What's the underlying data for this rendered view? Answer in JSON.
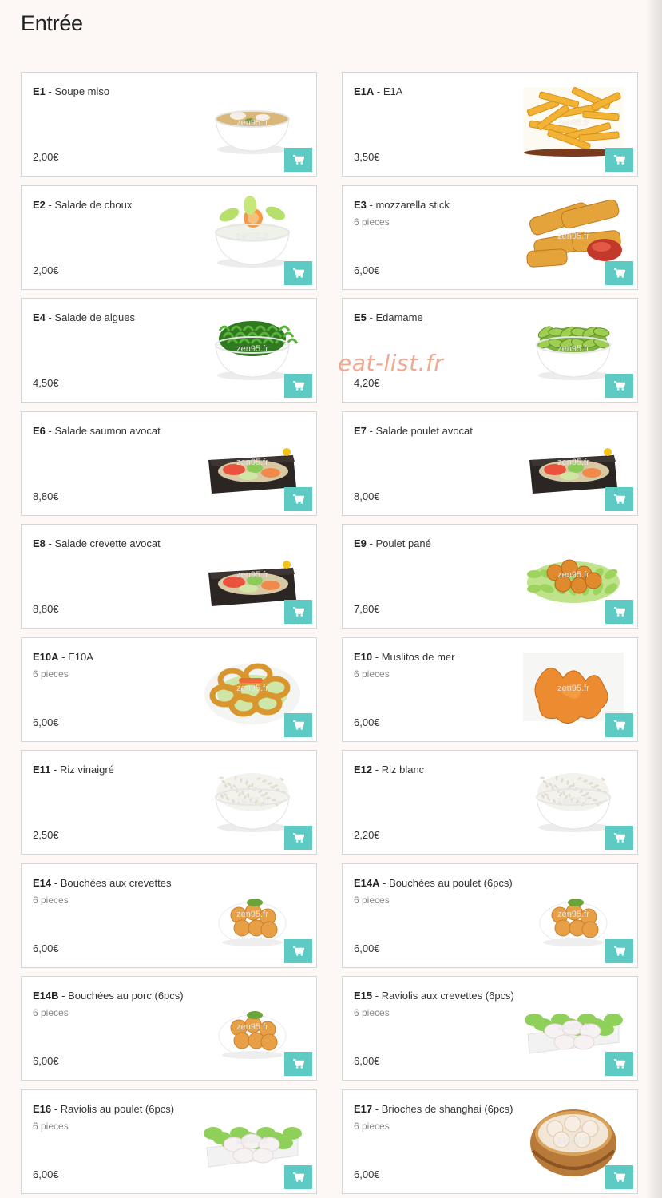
{
  "page": {
    "title": "Entrée"
  },
  "watermark": "eat-list.fr",
  "colors": {
    "cart_button": "#5dcbc3",
    "card_border": "#d6d6d6",
    "page_background": "#fdf8f6"
  },
  "items": [
    {
      "code": "E1",
      "name": "Soupe miso",
      "price": "2,00€",
      "desc": "",
      "image": "soup",
      "watermark": "zen95.fr"
    },
    {
      "code": "E1A",
      "name": "E1A",
      "price": "3,50€",
      "desc": "",
      "image": "fries",
      "watermark": "zen95.fr"
    },
    {
      "code": "E2",
      "name": "Salade de choux",
      "price": "2,00€",
      "desc": "",
      "image": "cabbage",
      "watermark": "zen95.fr"
    },
    {
      "code": "E3",
      "name": "mozzarella stick",
      "price": "6,00€",
      "desc": "6 pieces",
      "image": "sticks",
      "watermark": "zen95.fr"
    },
    {
      "code": "E4",
      "name": "Salade de algues",
      "price": "4,50€",
      "desc": "",
      "image": "seaweed",
      "watermark": "zen95.fr"
    },
    {
      "code": "E5",
      "name": "Edamame",
      "price": "4,20€",
      "desc": "",
      "image": "edamame",
      "watermark": "zen95.fr"
    },
    {
      "code": "E6",
      "name": "Salade saumon avocat",
      "price": "8,80€",
      "desc": "",
      "image": "salad-plate",
      "watermark": "zen95.fr"
    },
    {
      "code": "E7",
      "name": "Salade poulet avocat",
      "price": "8,00€",
      "desc": "",
      "image": "salad-plate",
      "watermark": "zen95.fr"
    },
    {
      "code": "E8",
      "name": "Salade crevette avocat",
      "price": "8,80€",
      "desc": "",
      "image": "salad-plate",
      "watermark": "zen95.fr"
    },
    {
      "code": "E9",
      "name": "Poulet pané",
      "price": "7,80€",
      "desc": "",
      "image": "chicken",
      "watermark": "zen95.fr"
    },
    {
      "code": "E10A",
      "name": "E10A",
      "price": "6,00€",
      "desc": "6 pieces",
      "image": "rings",
      "watermark": "zen95.fr"
    },
    {
      "code": "E10",
      "name": "Muslitos de mer",
      "price": "6,00€",
      "desc": "6 pieces",
      "image": "muslitos",
      "watermark": "zen95.fr"
    },
    {
      "code": "E11",
      "name": "Riz vinaigré",
      "price": "2,50€",
      "desc": "",
      "image": "rice",
      "watermark": "zen95.fr"
    },
    {
      "code": "E12",
      "name": "Riz blanc",
      "price": "2,20€",
      "desc": "",
      "image": "rice",
      "watermark": "zen95.fr"
    },
    {
      "code": "E14",
      "name": "Bouchées aux crevettes",
      "price": "6,00€",
      "desc": "6 pieces",
      "image": "dumplings",
      "watermark": "zen95.fr"
    },
    {
      "code": "E14A",
      "name": "Bouchées au poulet (6pcs)",
      "price": "6,00€",
      "desc": "6 pieces",
      "image": "dumplings",
      "watermark": "zen95.fr"
    },
    {
      "code": "E14B",
      "name": "Bouchées au porc (6pcs)",
      "price": "6,00€",
      "desc": "6 pieces",
      "image": "dumplings",
      "watermark": "zen95.fr"
    },
    {
      "code": "E15",
      "name": "Raviolis aux crevettes (6pcs)",
      "price": "6,00€",
      "desc": "6 pieces",
      "image": "raviolis",
      "watermark": "zen95.fr"
    },
    {
      "code": "E16",
      "name": "Raviolis au poulet (6pcs)",
      "price": "6,00€",
      "desc": "6 pieces",
      "image": "raviolis",
      "watermark": "zen95.fr"
    },
    {
      "code": "E17",
      "name": "Brioches de shanghai (6pcs)",
      "price": "6,00€",
      "desc": "6 pieces",
      "image": "steamer",
      "watermark": "zen95.fr"
    }
  ]
}
